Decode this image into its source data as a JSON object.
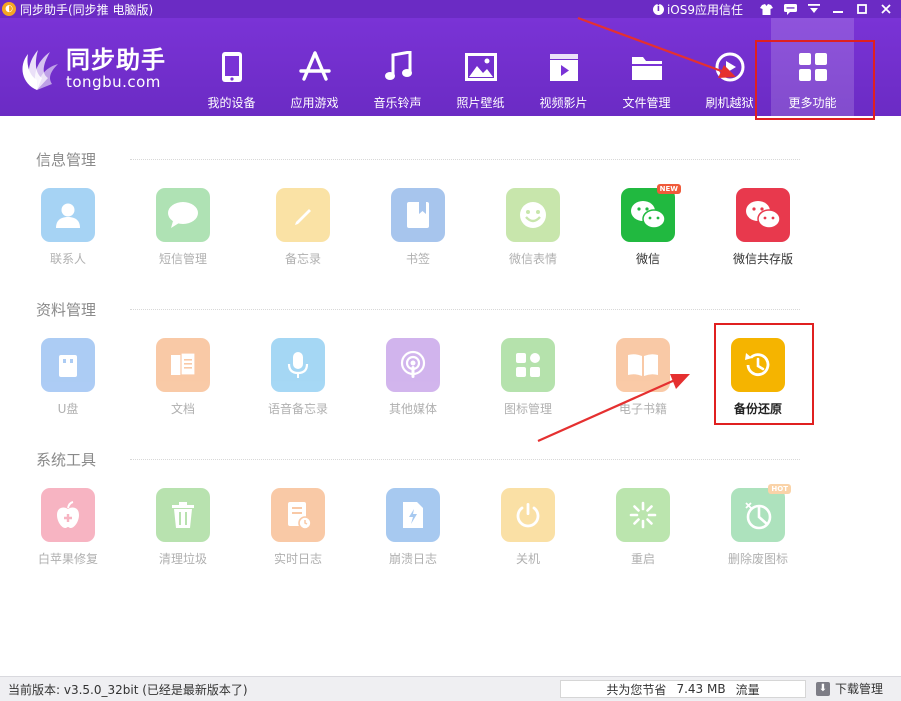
{
  "window": {
    "title": "同步助手(同步推 电脑版)",
    "ios_trust_label": "iOS9应用信任"
  },
  "brand": {
    "name_cn": "同步助手",
    "name_en": "tongbu.com"
  },
  "nav": [
    {
      "label": "我的设备",
      "icon": "phone-icon"
    },
    {
      "label": "应用游戏",
      "icon": "app-store-icon"
    },
    {
      "label": "音乐铃声",
      "icon": "music-note-icon"
    },
    {
      "label": "照片壁纸",
      "icon": "image-icon"
    },
    {
      "label": "视频影片",
      "icon": "film-icon"
    },
    {
      "label": "文件管理",
      "icon": "folder-icon"
    },
    {
      "label": "刷机越狱",
      "icon": "jailbreak-icon"
    },
    {
      "label": "更多功能",
      "icon": "grid-icon",
      "active": true
    }
  ],
  "sections": [
    {
      "title": "信息管理",
      "tiles": [
        {
          "label": "联系人",
          "icon": "contact-icon",
          "color": "#3b9fe8"
        },
        {
          "label": "短信管理",
          "icon": "message-icon",
          "color": "#4fc15a"
        },
        {
          "label": "备忘录",
          "icon": "pencil-icon",
          "color": "#f5c13a"
        },
        {
          "label": "书签",
          "icon": "bookmark-icon",
          "color": "#3d7fd9"
        },
        {
          "label": "微信表情",
          "icon": "smiley-icon",
          "color": "#86c84a"
        },
        {
          "label": "微信",
          "icon": "wechat-icon",
          "color": "#21b940",
          "badge": "NEW"
        },
        {
          "label": "微信共存版",
          "icon": "wechat-icon",
          "color": "#e8394d"
        }
      ]
    },
    {
      "title": "资料管理",
      "tiles": [
        {
          "label": "U盘",
          "icon": "usb-icon",
          "color": "#4a8fe8"
        },
        {
          "label": "文档",
          "icon": "document-icon",
          "color": "#f28a3c"
        },
        {
          "label": "语音备忘录",
          "icon": "microphone-icon",
          "color": "#3aa8e8"
        },
        {
          "label": "其他媒体",
          "icon": "podcast-icon",
          "color": "#9b5ad8"
        },
        {
          "label": "图标管理",
          "icon": "icon-grid-icon",
          "color": "#5cbf4a"
        },
        {
          "label": "电子书籍",
          "icon": "book-icon",
          "color": "#f38a3c"
        },
        {
          "label": "备份还原",
          "icon": "history-icon",
          "color": "#f5b400"
        }
      ]
    },
    {
      "title": "系统工具",
      "tiles": [
        {
          "label": "白苹果修复",
          "icon": "apple-plus-icon",
          "color": "#ee5a7a"
        },
        {
          "label": "清理垃圾",
          "icon": "trash-icon",
          "color": "#63c14f"
        },
        {
          "label": "实时日志",
          "icon": "log-icon",
          "color": "#f28a3c"
        },
        {
          "label": "崩溃日志",
          "icon": "crash-icon",
          "color": "#3d88e0"
        },
        {
          "label": "关机",
          "icon": "power-icon",
          "color": "#f5bb3a"
        },
        {
          "label": "重启",
          "icon": "restart-icon",
          "color": "#6ac64e"
        },
        {
          "label": "删除废图标",
          "icon": "pie-icon",
          "color": "#4bbf6f",
          "badge": "HOT"
        }
      ]
    }
  ],
  "status": {
    "version": "当前版本: v3.5.0_32bit  (已经是最新版本了)",
    "traffic_prefix": "共为您节省",
    "traffic_value": "7.43 MB",
    "traffic_suffix": "流量",
    "download_label": "下载管理"
  },
  "colors": {
    "header": "#6b2bc4",
    "highlight": "#e02020"
  }
}
